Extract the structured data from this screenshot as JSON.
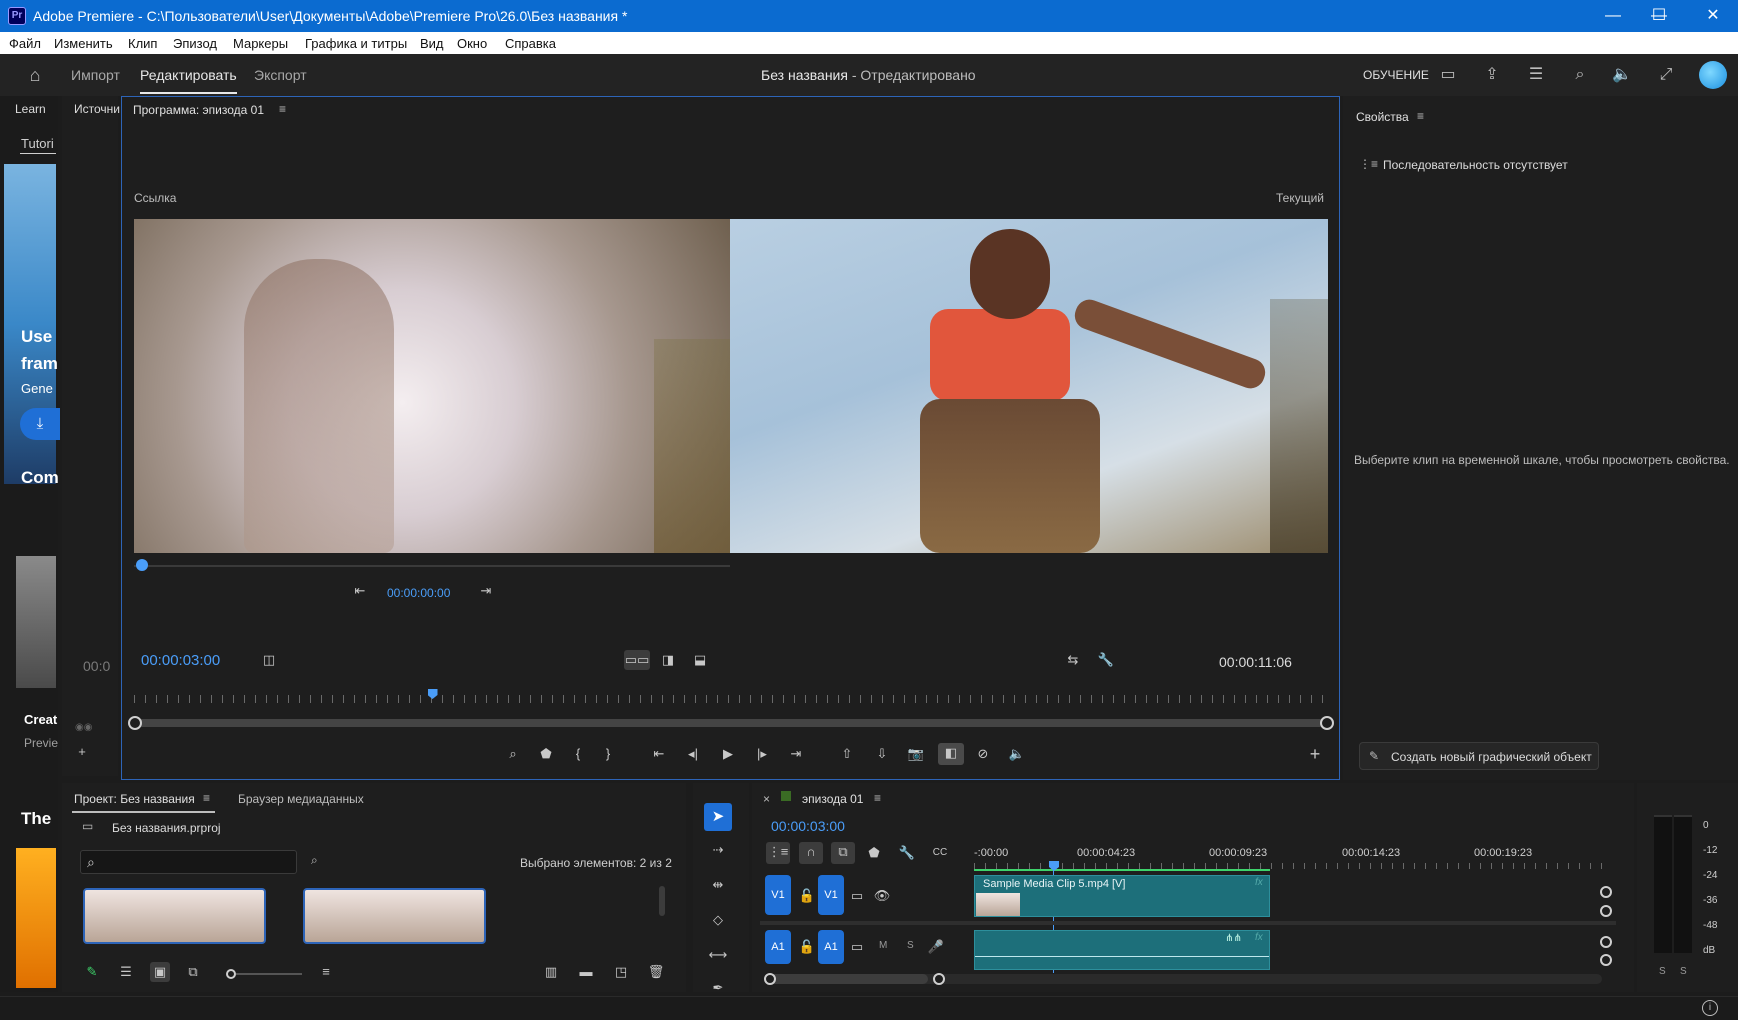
{
  "window": {
    "title": "Adobe Premiere - C:\\Пользователи\\User\\Документы\\Adobe\\Premiere Pro\\26.0\\Без названия *",
    "logo": "Pr",
    "minimize": "—",
    "maximize": "☐",
    "close": "✕"
  },
  "menu": [
    "Файл",
    "Изменить",
    "Клип",
    "Эпизод",
    "Маркеры",
    "Графика и титры",
    "Вид",
    "Окно",
    "Справка"
  ],
  "header": {
    "tabs": [
      "Импорт",
      "Редактировать",
      "Экспорт"
    ],
    "active_tab": "Редактировать",
    "project_title": "Без названия",
    "project_status": " - Отредактировано",
    "learn_label": "ОБУЧЕНИЕ"
  },
  "left_panel": {
    "tab_learn": "Learn",
    "tab_tutorials": "Tutori",
    "promo_line1": "Use",
    "promo_line2": "fram",
    "promo_line3": "Gene",
    "section_com": "Com",
    "card_title": "Creat",
    "card_sub": "Previe",
    "section_the": "The"
  },
  "source_panel": {
    "tab": "Источни",
    "timecode": "00:0"
  },
  "program": {
    "tab": "Программа: эпизода 01",
    "ref_label": "Ссылка",
    "current_label": "Текущий",
    "ref_timecode": "00:00:00:00",
    "timecode": "00:00:03:00",
    "duration": "00:00:11:06",
    "playhead_fraction": 0.25
  },
  "properties": {
    "tab": "Свойства",
    "no_sequence": "Последовательность отсутствует",
    "hint": "Выберите клип на временной шкале, чтобы просмотреть свойства.",
    "create_graphic": "Создать новый графический объект"
  },
  "project": {
    "tab_project": "Проект: Без названия",
    "tab_browser": "Браузер медиаданных",
    "file": "Без названия.prproj",
    "selected": "Выбрано элементов: 2 из 2"
  },
  "timeline": {
    "tab": "эпизода 01",
    "timecode": "00:00:03:00",
    "ruler": [
      "-:00:00",
      "00:00:04:23",
      "00:00:09:23",
      "00:00:14:23",
      "00:00:19:23"
    ],
    "v1": "V1",
    "a1": "A1",
    "clip_label": "Sample Media Clip 5.mp4 [V]",
    "fx": "fx",
    "mute": "M",
    "solo": "S"
  },
  "audio_meter": {
    "scale": [
      "0",
      "-12",
      "-24",
      "-36",
      "-48",
      "dB"
    ],
    "solo_l": "S",
    "solo_r": "S"
  },
  "colors": {
    "titlebar": "#0b6bd0",
    "accent": "#4a9df8",
    "clip": "#1d6f7a",
    "panel_focus": "#2d64b8"
  }
}
